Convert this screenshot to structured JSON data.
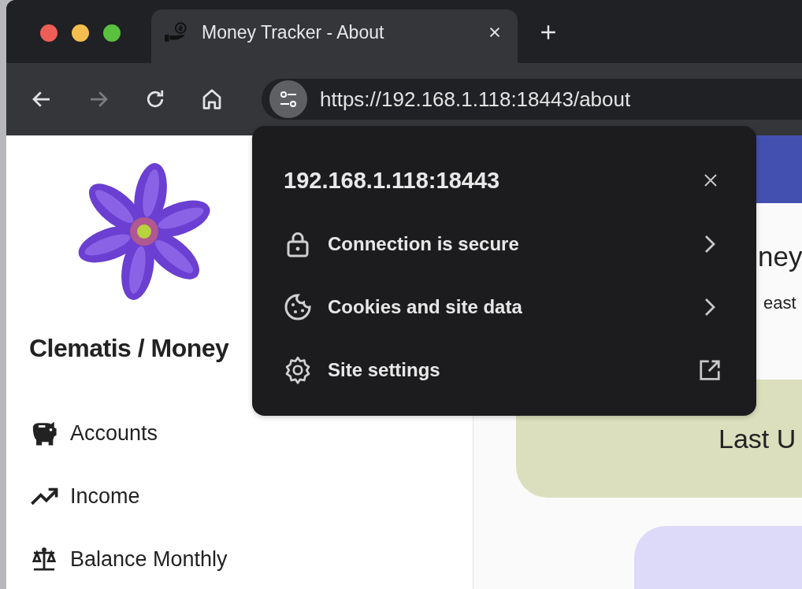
{
  "browser": {
    "tab": {
      "title": "Money Tracker - About"
    },
    "back_disabled": false,
    "forward_disabled": true,
    "address": "https://192.168.1.118:18443/about"
  },
  "site_info": {
    "host": "192.168.1.118:18443",
    "items": [
      {
        "kind": "submenu",
        "label": "Connection is secure"
      },
      {
        "kind": "submenu",
        "label": "Cookies and site data"
      },
      {
        "kind": "external",
        "label": "Site settings"
      }
    ]
  },
  "sidebar": {
    "title": "Clematis / Money",
    "items": [
      {
        "label": "Accounts"
      },
      {
        "label": "Income"
      },
      {
        "label": "Balance Monthly"
      }
    ]
  },
  "main": {
    "heading": "ney",
    "subtitle": "east",
    "cards": [
      {
        "text": "Last U",
        "color": "#dbdfbd"
      },
      {
        "color": "#dcdaf8"
      }
    ]
  }
}
